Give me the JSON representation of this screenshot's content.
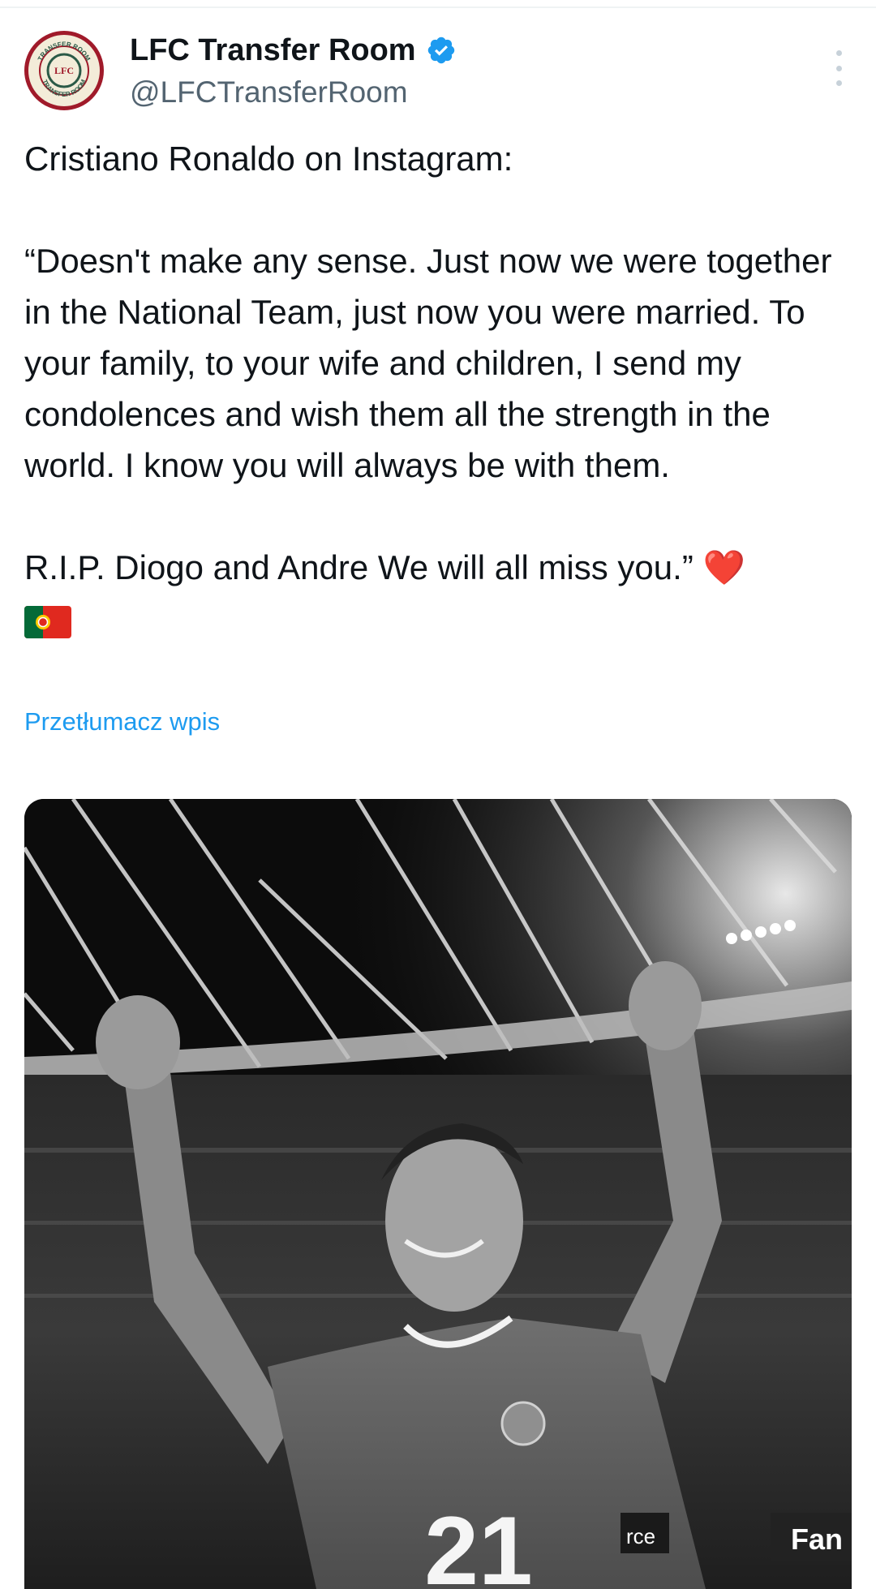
{
  "tweet": {
    "display_name": "LFC Transfer Room",
    "handle": "@LFCTransferRoom",
    "verified_icon": "verified-badge-icon",
    "more_icon": "more-options-icon",
    "text_lines": [
      "Cristiano Ronaldo on Instagram:",
      "",
      "“Doesn't make any sense. Just now we were together in the National Team, just now you were married. To your family, to your wife and children, I send my condolences and wish them all the strength in the world. I know you will always be with them.",
      "",
      "R.I.P. Diogo and Andre We will all miss you.” ❤️"
    ],
    "translate_label": "Przetłumacz wpis"
  },
  "avatar": {
    "ring_text_top": "TRANSFER ROOM",
    "ring_text_bottom": "TRANSFER ROOM",
    "center_monogram": "LFC"
  },
  "media": {
    "jersey_number": "21",
    "board_text": "Fan",
    "board_text_left": "rce"
  },
  "colors": {
    "accent_blue": "#1d9bf0",
    "avatar_ring": "#a01a2a",
    "heart": "#e0245e"
  }
}
